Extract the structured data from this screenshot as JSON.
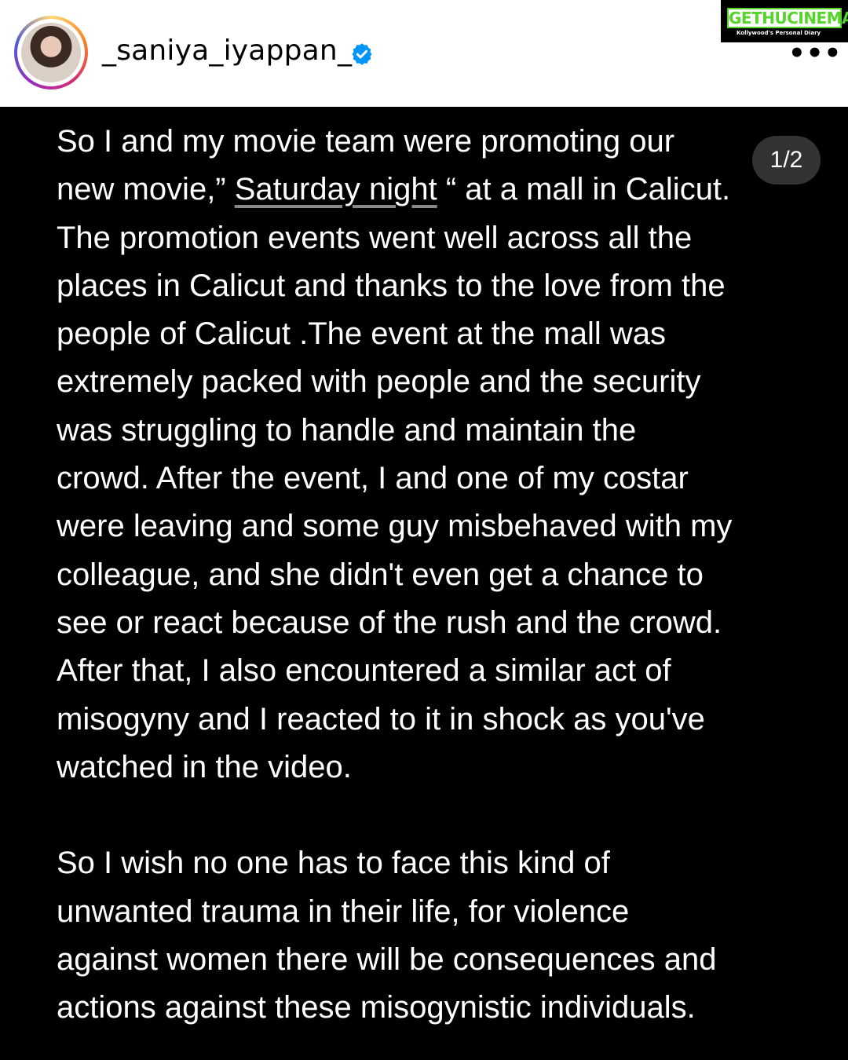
{
  "post_header": {
    "username": "_saniya_iyappan_",
    "verified": true,
    "more_icon": "ellipsis-horizontal-icon",
    "avatar_icon": "profile-photo"
  },
  "watermark": {
    "title": "GETHUCINEMA",
    "tagline": "Kollywood's Personal Diary"
  },
  "slide_counter": "1/2",
  "post_text": {
    "para1_part1": "So I and my movie team were promoting our\nnew movie,” ",
    "para1_link": "Saturday night",
    "para1_part2": " “ at a mall in Calicut.\nThe promotion events  went well across all the\nplaces in Calicut and thanks to the love from the\npeople of Calicut .The event at the mall was\nextremely packed with people and the security\nwas struggling to handle and maintain the\ncrowd. After the event, I and one of my costar\nwere leaving and some guy misbehaved with my\ncolleague, and she didn't even get a chance to\nsee or react because of the rush and the crowd.\nAfter that, I also encountered a similar act of\nmisogyny and I reacted to it in shock as you've\nwatched in the video.",
    "para2": "So I wish no one has to face this kind of\nunwanted trauma in their life, for violence\nagainst women there will be consequences and\nactions against these misogynistic individuals."
  },
  "colors": {
    "background": "#000000",
    "text": "#ffffff",
    "verified_badge": "#0095f6",
    "watermark_green": "#55d42a"
  }
}
